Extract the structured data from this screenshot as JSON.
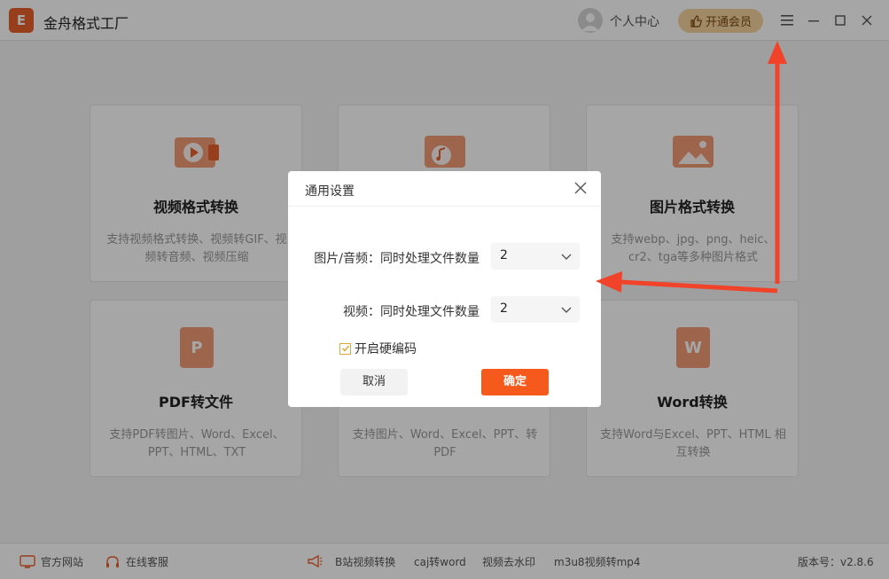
{
  "app": {
    "title": "金舟格式工厂",
    "logo_glyph": "E"
  },
  "header": {
    "user_label": "个人中心",
    "vip_label": "开通会员",
    "menu_icon": "menu-icon",
    "minimize_icon": "minimize-icon",
    "maximize_icon": "maximize-icon",
    "close_icon": "close-icon"
  },
  "cards": [
    {
      "title": "视频格式转换",
      "desc": "支持视频格式转换、视频转GIF、视频转音频、视频压缩",
      "icon": "video-icon"
    },
    {
      "title": "",
      "desc": "",
      "icon": "audio-icon"
    },
    {
      "title": "图片格式转换",
      "desc": "支持webp、jpg、png、heic、cr2、tga等多种图片格式",
      "icon": "image-icon"
    },
    {
      "title": "PDF转文件",
      "desc": "支持PDF转图片、Word、Excel、PPT、HTML、TXT",
      "icon": "pdf-icon"
    },
    {
      "title": "",
      "desc": "支持图片、Word、Excel、PPT、转PDF",
      "icon": "to-pdf-icon"
    },
    {
      "title": "Word转换",
      "desc": "支持Word与Excel、PPT、HTML 相互转换",
      "icon": "word-icon"
    }
  ],
  "footer": {
    "website": "官方网站",
    "support": "在线客服",
    "links": [
      "B站视频转换",
      "caj转word",
      "视频去水印",
      "m3u8视频转mp4"
    ],
    "version": "版本号：v2.8.6"
  },
  "dialog": {
    "title": "通用设置",
    "row1_label": "图片/音频：同时处理文件数量",
    "row1_value": "2",
    "row2_label": "视频：同时处理文件数量",
    "row2_value": "2",
    "checkbox_label": "开启硬编码",
    "checkbox_checked": true,
    "cancel": "取消",
    "ok": "确定"
  },
  "colors": {
    "accent": "#f55a1c",
    "vip": "#f4d39d",
    "annotation_arrow": "#f0432a"
  }
}
